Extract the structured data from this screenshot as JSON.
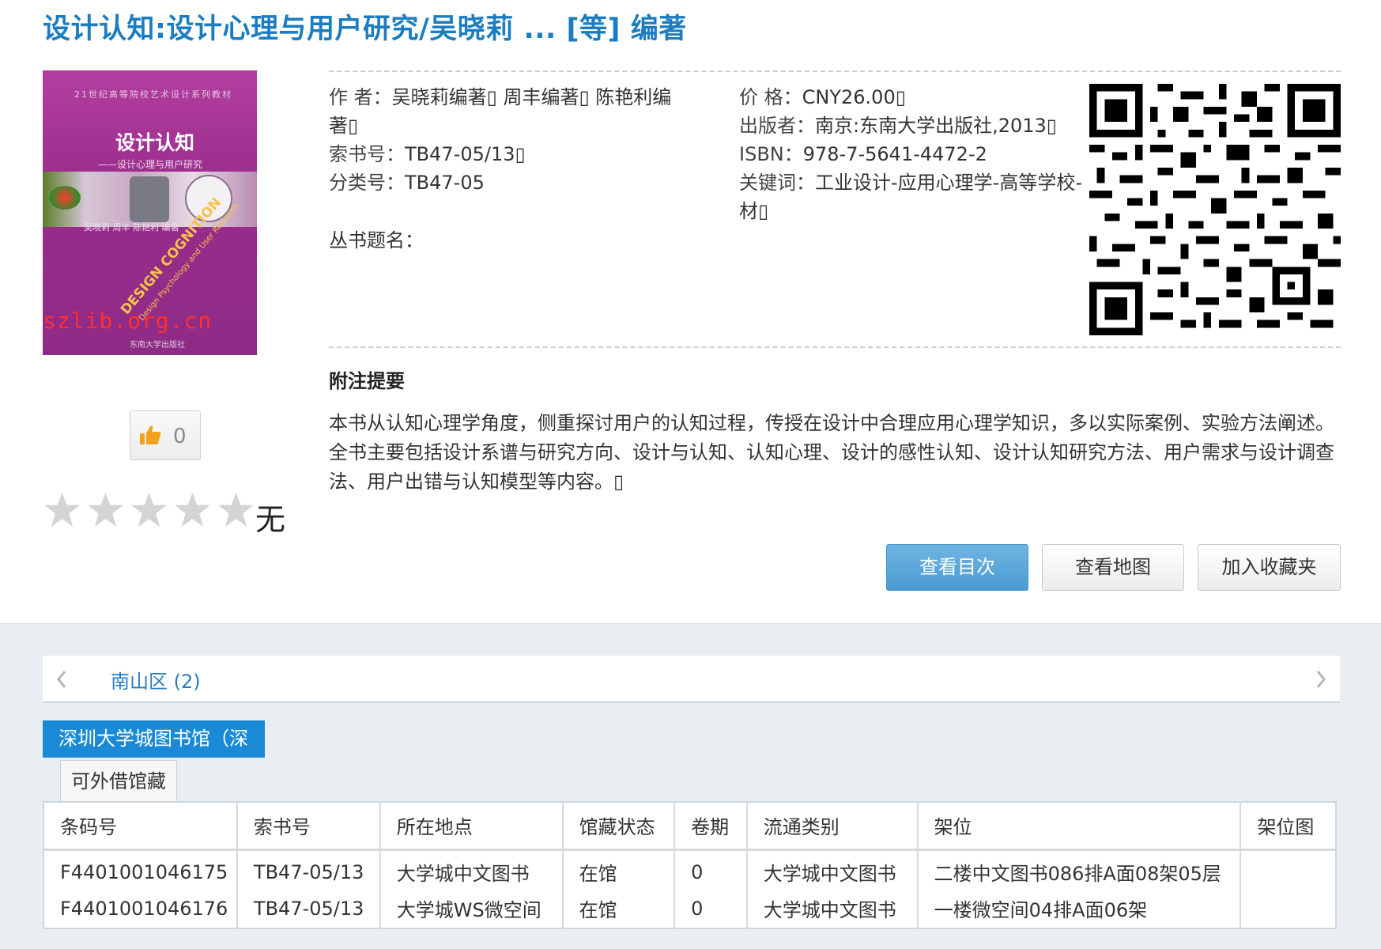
{
  "title": "设计认知:设计心理与用户研究/吴晓莉 ... [等] 编著",
  "cover": {
    "series": "21世纪高等院校艺术设计系列教材",
    "title": "设计认知",
    "subtitle": "——设计心理与用户研究",
    "authors": "吴晓莉 周丰 陈艳利 编著",
    "english": "DESIGN COGNITION",
    "english_sub": "Design Psychology and User Research",
    "watermark": "szlib.org.cn",
    "publisher": "东南大学出版社"
  },
  "like": {
    "count": "0"
  },
  "rating": {
    "stars": 0,
    "max": 5,
    "text": "无"
  },
  "fields": {
    "author_label": "作 者：",
    "author_value": "吴晓莉编著▯ 周丰编著▯ 陈艳利编",
    "author_value2": "著▯",
    "call_label": "索书号：",
    "call_value": "TB47-05/13▯",
    "class_label": "分类号：",
    "class_value": "TB47-05",
    "series_label": "丛书题名：",
    "price_label": "价 格：",
    "price_value": "CNY26.00▯",
    "publisher_label": "出版者：",
    "publisher_value": "南京:东南大学出版社,2013▯",
    "isbn_label": "ISBN：",
    "isbn_value": "978-7-5641-4472-2",
    "keywords_label": "关键词：",
    "keywords_value": "工业设计-应用心理学-高等学校-",
    "keywords_value2": "材▯"
  },
  "notes": {
    "heading": "附注提要",
    "body": "本书从认知心理学角度，侧重探讨用户的认知过程，传授在设计中合理应用心理学知识，多以实际案例、实验方法阐述。全书主要包括设计系谱与研究方向、设计与认知、认知心理、设计的感性认知、设计认知研究方法、用户需求与设计调查法、用户出错与认知模型等内容。▯"
  },
  "buttons": {
    "toc": "查看目次",
    "map": "查看地图",
    "favorite": "加入收藏夹"
  },
  "holdings": {
    "district": "南山区 (2)",
    "library_tab": "深圳大学城图书馆（深",
    "sub_tab": "可外借馆藏",
    "columns": [
      "条码号",
      "索书号",
      "所在地点",
      "馆藏状态",
      "卷期",
      "流通类别",
      "架位",
      "架位图"
    ],
    "rows": [
      [
        "F4401001046175",
        "TB47-05/13",
        "大学城中文图书",
        "在馆",
        "0",
        "大学城中文图书",
        "二楼中文图书086排A面08架05层",
        ""
      ],
      [
        "F4401001046176",
        "TB47-05/13",
        "大学城WS微空间",
        "在馆",
        "0",
        "大学城中文图书",
        "一楼微空间04排A面06架",
        ""
      ]
    ]
  },
  "colors": {
    "title_blue": "#1a7cc1",
    "tab_blue": "#1a8ad6",
    "button_blue": "#4a9bd2",
    "bottom_bg": "#e9eef2"
  }
}
